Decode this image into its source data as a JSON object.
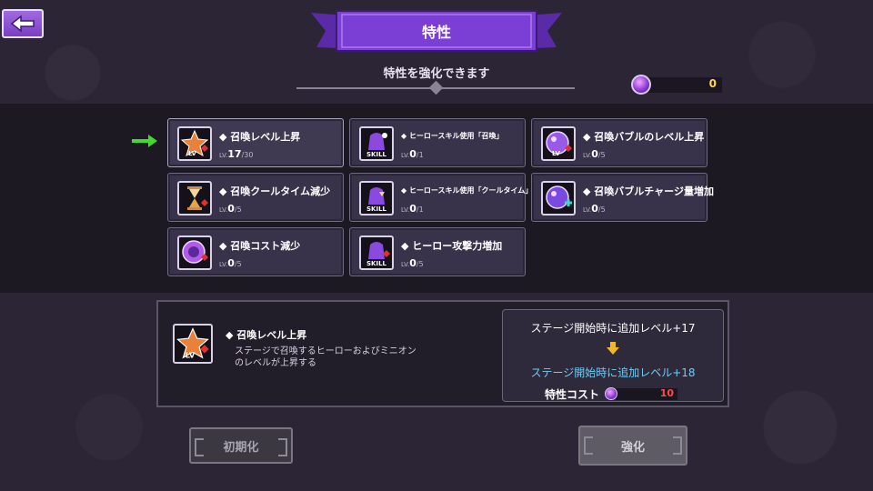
{
  "header": {
    "title": "特性",
    "subtitle": "特性を強化できます"
  },
  "currency": {
    "amount": "0"
  },
  "traits": [
    {
      "name": "召喚レベル上昇",
      "lv_prefix": "LV.",
      "level": "17",
      "max": "/30",
      "icon": "summon-level-star-icon"
    },
    {
      "name": "ヒーロースキル使用「召喚」",
      "lv_prefix": "LV.",
      "level": "0",
      "max": "/1",
      "icon": "skill-hero-icon"
    },
    {
      "name": "召喚バブルのレベル上昇",
      "lv_prefix": "LV.",
      "level": "0",
      "max": "/5",
      "icon": "bubble-level-icon"
    },
    {
      "name": "召喚クールタイム減少",
      "lv_prefix": "LV.",
      "level": "0",
      "max": "/5",
      "icon": "hourglass-icon"
    },
    {
      "name": "ヒーロースキル使用「クールタイム」",
      "lv_prefix": "LV.",
      "level": "0",
      "max": "/1",
      "icon": "skill-hourglass-icon"
    },
    {
      "name": "召喚バブルチャージ量増加",
      "lv_prefix": "LV.",
      "level": "0",
      "max": "/5",
      "icon": "bubble-charge-icon"
    },
    {
      "name": "召喚コスト減少",
      "lv_prefix": "LV.",
      "level": "0",
      "max": "/5",
      "icon": "orb-cost-icon"
    },
    {
      "name": "ヒーロー攻撃力増加",
      "lv_prefix": "LV.",
      "level": "0",
      "max": "/5",
      "icon": "skill-attack-icon"
    }
  ],
  "detail": {
    "name": "召喚レベル上昇",
    "description": "ステージで召喚するヒーローおよびミニオンのレベルが上昇する",
    "current_effect": "ステージ開始時に追加レベル+17",
    "next_effect": "ステージ開始時に追加レベル+18",
    "cost_label": "特性コスト",
    "cost_value": "10"
  },
  "buttons": {
    "reset": "初期化",
    "upgrade": "強化"
  },
  "colors": {
    "ribbon": "#7b3fd6",
    "cost": "#ff4a4a",
    "next_effect": "#6ecdf7",
    "currency": "#ffd84a",
    "pointer_arrow": "#3fdc2c"
  }
}
